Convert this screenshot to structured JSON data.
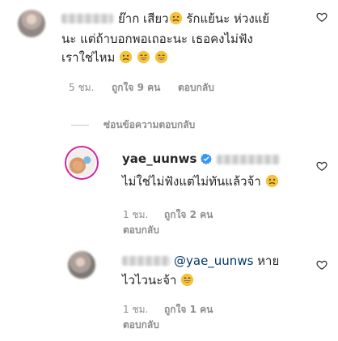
{
  "comment1": {
    "line1_text": "ย๊าก เสียว",
    "line1_rest": " รักแย้นะ ห่วงแย้",
    "line2_text": "นะ แต่ถ้าบอกพอเถอะนะ เธอคงไม่ฟัง",
    "line3_text": "เราใช่ไหม",
    "time": "5 ชม.",
    "likes": "ถูกใจ 9 คน",
    "reply": "ตอบกลับ"
  },
  "hide_replies": "ซ่อนข้อความตอบกลับ",
  "reply1": {
    "username": "yae_uunws",
    "text": "ไม่ใช่ไม่ฟังแต่ไม่ทันแล้วจ้า",
    "time": "1 ชม.",
    "likes": "ถูกใจ 2 คน",
    "reply": "ตอบกลับ"
  },
  "reply2": {
    "mention": "@yae_uunws",
    "text_line1_rest": " หาย",
    "text_line2": "ไวไวนะจ้า",
    "time": "1 ชม.",
    "likes": "ถูกใจ 1 คน",
    "reply": "ตอบกลับ"
  },
  "colors": {
    "verified": "#3897f0",
    "meta_text": "#8e8e8e",
    "mention": "#00376b",
    "story_ring": "#d6249f"
  },
  "icons": {
    "like": "heart-outline-icon",
    "verified": "verified-badge-icon",
    "emoji_sad": "sad-face-emoji",
    "emoji_grin": "grinning-face-emoji"
  }
}
